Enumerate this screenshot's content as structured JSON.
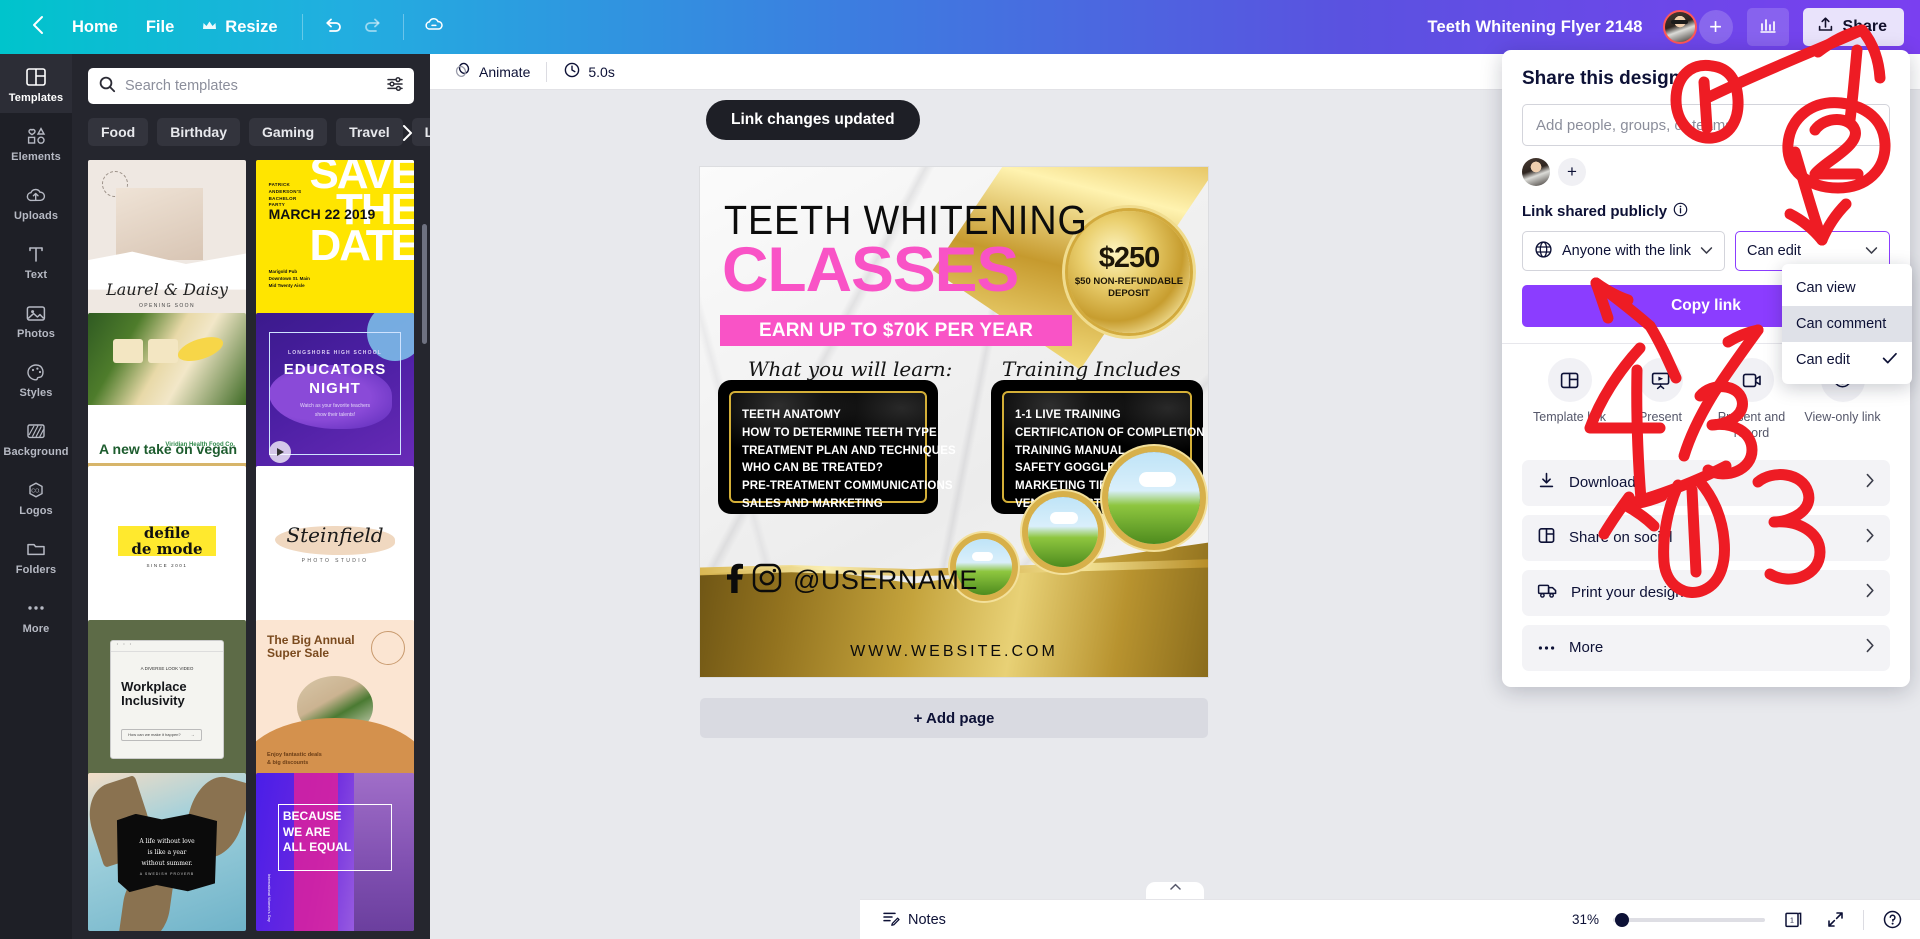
{
  "topbar": {
    "back_icon": "chevron-left-icon",
    "home_label": "Home",
    "file_label": "File",
    "resize_label": "Resize",
    "resize_icon": "crown-icon",
    "undo_icon": "undo-icon",
    "redo_icon": "redo-icon",
    "cloud_icon": "cloud-sync-icon",
    "doc_title": "Teeth Whitening Flyer 2148",
    "add_member_label": "+",
    "stats_icon": "bar-chart-icon",
    "share_label": "Share",
    "share_icon": "upload-icon",
    "gradient_start": "#00c4cc",
    "gradient_end": "#7a3ff0"
  },
  "rail": {
    "items": [
      {
        "label": "Templates",
        "icon": "templates-icon",
        "active": true
      },
      {
        "label": "Elements",
        "icon": "elements-icon",
        "active": false
      },
      {
        "label": "Uploads",
        "icon": "uploads-icon",
        "active": false
      },
      {
        "label": "Text",
        "icon": "text-icon",
        "active": false
      },
      {
        "label": "Photos",
        "icon": "photos-icon",
        "active": false
      },
      {
        "label": "Styles",
        "icon": "styles-icon",
        "active": false
      },
      {
        "label": "Background",
        "icon": "background-icon",
        "active": false
      },
      {
        "label": "Logos",
        "icon": "logos-icon",
        "active": false
      },
      {
        "label": "Folders",
        "icon": "folders-icon",
        "active": false
      },
      {
        "label": "More",
        "icon": "more-icon",
        "active": false
      }
    ]
  },
  "panel": {
    "search": {
      "placeholder": "Search templates",
      "value": "",
      "icon": "search-icon",
      "filter_icon": "filter-icon"
    },
    "chips": [
      "Food",
      "Birthday",
      "Gaming",
      "Travel",
      "Lo"
    ],
    "chips_next_icon": "chevron-right-icon",
    "templates": [
      {
        "name": "Laurel & Daisy",
        "sub": "OPENING SOON"
      },
      {
        "name": "SAVE THE DATE",
        "sub": "MARCH 22 2019"
      },
      {
        "name": "A new take on vegan",
        "sub": "Viridian Health Food Co."
      },
      {
        "name": "EDUCATORS NIGHT",
        "sub": "LONGSHORE HIGH SCHOOL"
      },
      {
        "name": "defile de mode",
        "sub": "SINCE 2001"
      },
      {
        "name": "Steinfield",
        "sub": "PHOTO STUDIO"
      },
      {
        "name": "Workplace Inclusivity",
        "sub": "How can we make it happen?"
      },
      {
        "name": "The Big Annual Super Sale",
        "sub": "Enjoy fantastic deals & big discounts"
      },
      {
        "name": "A life without love is like a year without summer.",
        "sub": "A SWEDISH PROVERB"
      },
      {
        "name": "BECAUSE WE ARE ALL EQUAL",
        "sub": ""
      }
    ]
  },
  "editor": {
    "animate_label": "Animate",
    "animate_icon": "animate-icon",
    "duration_label": "5.0s",
    "duration_icon": "clock-icon",
    "toast": "Link changes updated",
    "page_tools": [
      "duplicate-page-icon",
      "page-options-icon"
    ],
    "add_page_label": "+ Add page"
  },
  "flyer": {
    "heading": "TEETH WHITENING",
    "subheading": "CLASSES",
    "band": "EARN UP TO $70K PER YEAR",
    "seal_price": "$250",
    "seal_note": "$50 NON-REFUNDABLE DEPOSIT",
    "left_title": "What you will learn:",
    "right_title": "Training Includes",
    "left_items": [
      "TEETH ANATOMY",
      "HOW TO DETERMINE TEETH TYPE",
      "TREATMENT PLAN AND TECHNIQUES",
      "WHO CAN BE TREATED?",
      "PRE-TREATMENT COMMUNICATIONS",
      "SALES AND MARKETING"
    ],
    "right_items": [
      "1-1 LIVE TRAINING",
      "CERTIFICATION OF COMPLETION",
      "TRAINING MANUAL",
      "SAFETY GOGGLES",
      "MARKETING TIPS",
      "VENDORS LISTS"
    ],
    "handle": "@USERNAME",
    "facebook_icon": "facebook-icon",
    "instagram_icon": "instagram-icon",
    "website": "WWW.WEBSITE.COM",
    "accent_pink": "#f953c6",
    "accent_gold": "#d4af37"
  },
  "share": {
    "title": "Share this design",
    "people_placeholder": "Add people, groups, or teams",
    "people_value": "",
    "add_person_label": "+",
    "link_status": "Link shared publicly",
    "info_icon": "info-icon",
    "audience_value": "Anyone with the link",
    "audience_icon": "globe-icon",
    "permission_value": "Can edit",
    "copy_label": "Copy link",
    "actions": [
      {
        "label": "Template link",
        "icon": "template-link-icon"
      },
      {
        "label": "Present",
        "icon": "present-icon"
      },
      {
        "label": "Present and record",
        "icon": "present-record-icon"
      },
      {
        "label": "View-only link",
        "icon": "view-only-icon"
      }
    ],
    "rows": [
      {
        "label": "Download",
        "icon": "download-icon"
      },
      {
        "label": "Share on social",
        "icon": "share-social-icon"
      },
      {
        "label": "Print your design",
        "icon": "print-icon"
      },
      {
        "label": "More",
        "icon": "more-dots-icon"
      }
    ],
    "permission_menu": {
      "items": [
        {
          "label": "Can view",
          "checked": false,
          "hovered": false
        },
        {
          "label": "Can comment",
          "checked": false,
          "hovered": true
        },
        {
          "label": "Can edit",
          "checked": true,
          "hovered": false
        }
      ]
    },
    "accent": "#8b3dff"
  },
  "bottombar": {
    "notes_label": "Notes",
    "notes_icon": "notes-icon",
    "zoom_value": "31%",
    "pages_icon": "pages-icon",
    "fullscreen_icon": "fullscreen-icon",
    "help_icon": "help-icon"
  },
  "annotations": {
    "color": "#ee1c24",
    "marks": [
      "1",
      "2",
      "3",
      "4"
    ]
  }
}
